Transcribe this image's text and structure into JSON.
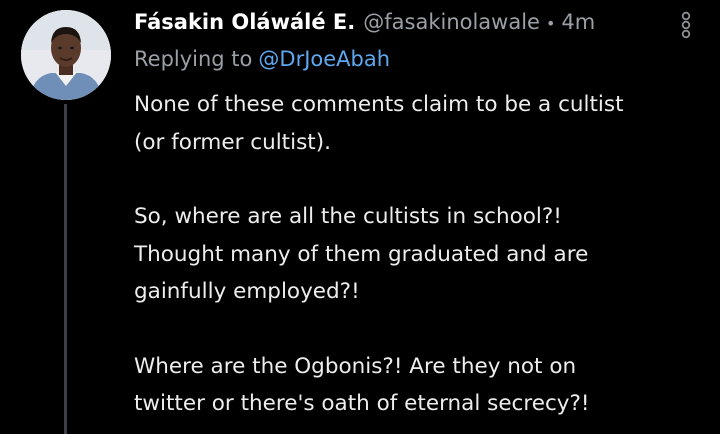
{
  "theme": {
    "background": "#000000",
    "text": "#ededed",
    "muted": "#9aa0a6",
    "link": "#5ea8f0",
    "thread_line": "#3d4147"
  },
  "tweet": {
    "author_name": "Fásakin Oláwálé E.",
    "handle": "@fasakinolawale",
    "separator": "•",
    "time": "4m",
    "replying_to_label": "Replying to",
    "replying_to_handle": "@DrJoeAbah",
    "more_icon": "vertical-dots-icon",
    "avatar_icon": "profile-photo",
    "paragraphs": [
      [
        "None of these comments claim to be a cultist",
        "(or former cultist)."
      ],
      [
        "So, where are all the cultists in school?!",
        "Thought many of them graduated and are",
        "gainfully employed?!"
      ],
      [
        "Where are the Ogbonis?! Are they not on",
        "twitter or there's oath of eternal secrecy?!"
      ]
    ]
  }
}
